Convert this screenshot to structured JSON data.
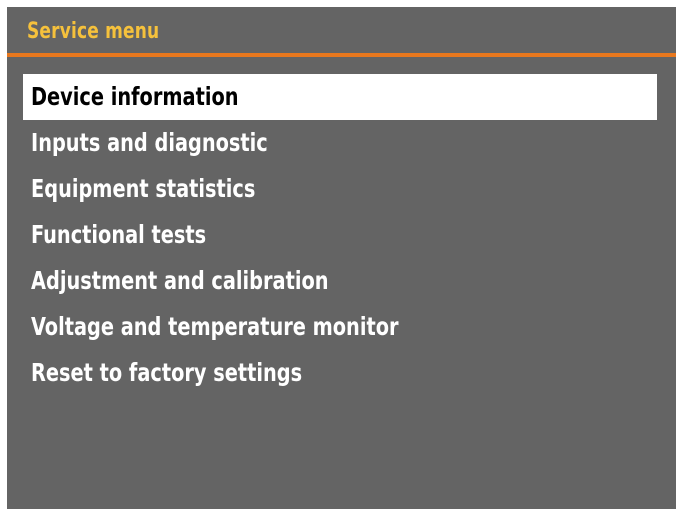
{
  "title": "Service menu",
  "colors": {
    "screen_background": "#646464",
    "title_text": "#f5c13c",
    "title_rule": "#e8781e",
    "item_text": "#ffffff",
    "selected_background": "#ffffff",
    "selected_text": "#000000"
  },
  "selected_index": 0,
  "menu": {
    "items": [
      {
        "label": "Device information"
      },
      {
        "label": "Inputs and diagnostic"
      },
      {
        "label": "Equipment statistics"
      },
      {
        "label": "Functional tests"
      },
      {
        "label": "Adjustment and calibration"
      },
      {
        "label": "Voltage and temperature monitor"
      },
      {
        "label": "Reset to factory settings"
      }
    ]
  }
}
